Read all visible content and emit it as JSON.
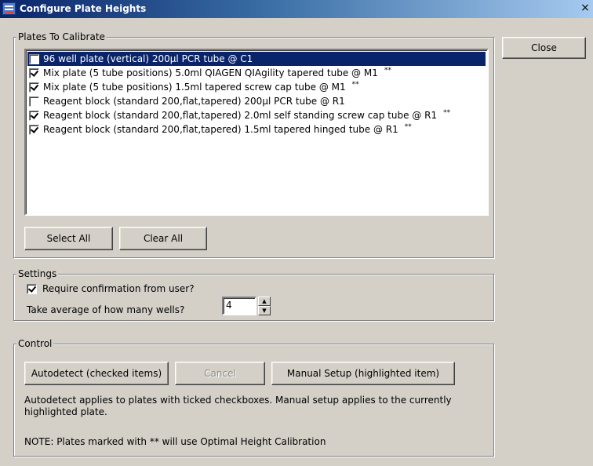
{
  "window": {
    "title": "Configure Plate Heights",
    "close_glyph": "×"
  },
  "close_button_label": "Close",
  "plates_group": {
    "legend": "Plates To Calibrate",
    "items": [
      {
        "label": "96 well plate (vertical) 200µl PCR tube @ C1",
        "checked": false,
        "selected": true,
        "marker": ""
      },
      {
        "label": "Mix plate (5 tube positions) 5.0ml QIAGEN QIAgility tapered tube @ M1",
        "checked": true,
        "selected": false,
        "marker": "**"
      },
      {
        "label": "Mix plate (5 tube positions) 1.5ml tapered screw cap tube @ M1",
        "checked": true,
        "selected": false,
        "marker": "**"
      },
      {
        "label": "Reagent block (standard 200,flat,tapered) 200µl PCR tube @ R1",
        "checked": false,
        "selected": false,
        "marker": ""
      },
      {
        "label": "Reagent block (standard 200,flat,tapered) 2.0ml self standing screw cap tube @ R1",
        "checked": true,
        "selected": false,
        "marker": "**"
      },
      {
        "label": "Reagent block (standard 200,flat,tapered) 1.5ml tapered hinged tube @ R1",
        "checked": true,
        "selected": false,
        "marker": "**"
      }
    ],
    "select_all_label": "Select All",
    "clear_all_label": "Clear All"
  },
  "settings_group": {
    "legend": "Settings",
    "require_confirmation_label": "Require confirmation from user?",
    "require_confirmation_checked": true,
    "average_wells_label": "Take average of how many wells?",
    "average_wells_value": "4"
  },
  "control_group": {
    "legend": "Control",
    "autodetect_label": "Autodetect (checked items)",
    "cancel_label": "Cancel",
    "manual_setup_label": "Manual Setup (highlighted item)",
    "help_line1": "Autodetect applies to plates with ticked checkboxes. Manual setup applies to the currently",
    "help_line2": "highlighted plate.",
    "note": "NOTE: Plates marked with ** will use Optimal Height Calibration"
  },
  "icons": {
    "app_icon": "plate-grid-icon",
    "spin_up": "arrow-up-icon",
    "spin_down": "arrow-down-icon"
  },
  "colors": {
    "selection": "#0a246a",
    "face": "#d4d0c8"
  }
}
